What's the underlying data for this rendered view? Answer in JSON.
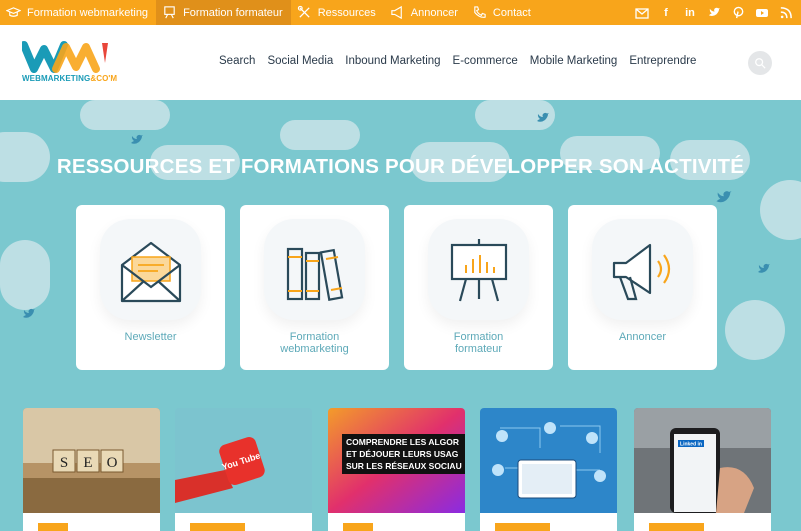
{
  "topbar": {
    "items": [
      {
        "label": "Formation webmarketing",
        "icon": "mortarboard-icon",
        "active": false
      },
      {
        "label": "Formation formateur",
        "icon": "presentation-icon",
        "active": true
      },
      {
        "label": "Ressources",
        "icon": "tools-icon",
        "active": false
      },
      {
        "label": "Annoncer",
        "icon": "megaphone-icon",
        "active": false
      },
      {
        "label": "Contact",
        "icon": "phone-icon",
        "active": false
      }
    ],
    "social": [
      "newsletter-icon",
      "facebook-icon",
      "linkedin-icon",
      "twitter-icon",
      "pinterest-icon",
      "youtube-icon",
      "rss-icon"
    ],
    "social_glyphs": {
      "facebook": "f",
      "linkedin": "in"
    }
  },
  "logo": {
    "text_part1": "WEBMARKETING",
    "text_part2": "&CO'M"
  },
  "nav": [
    "Search",
    "Social Media",
    "Inbound Marketing",
    "E-commerce",
    "Mobile Marketing",
    "Entreprendre"
  ],
  "hero": {
    "title": "RESSOURCES ET FORMATIONS POUR DÉVELOPPER SON ACTIVITÉ",
    "cards": [
      {
        "line1": "Newsletter",
        "line2": ""
      },
      {
        "line1": "Formation",
        "line2": "webmarketing"
      },
      {
        "line1": "Formation",
        "line2": "formateur"
      },
      {
        "line1": "Annoncer",
        "line2": ""
      }
    ]
  },
  "articles": [
    {
      "image": "seo-scrabble-tiles",
      "tiles": [
        "S",
        "E",
        "O"
      ]
    },
    {
      "image": "youtube-hand",
      "badge": "You Tube"
    },
    {
      "image": "algorithms-banner",
      "text": [
        "COMPRENDRE LES ALGOR",
        "ET DÉJOUER LEURS USAG",
        "SUR LES RÉSEAUX SOCIAU"
      ]
    },
    {
      "image": "network-tablet"
    },
    {
      "image": "linkedin-phone",
      "badge": "Linked in"
    }
  ],
  "colors": {
    "accent": "#f8a51b",
    "hero_bg": "#7bc8cf",
    "brand_teal": "#1a9bb7"
  }
}
